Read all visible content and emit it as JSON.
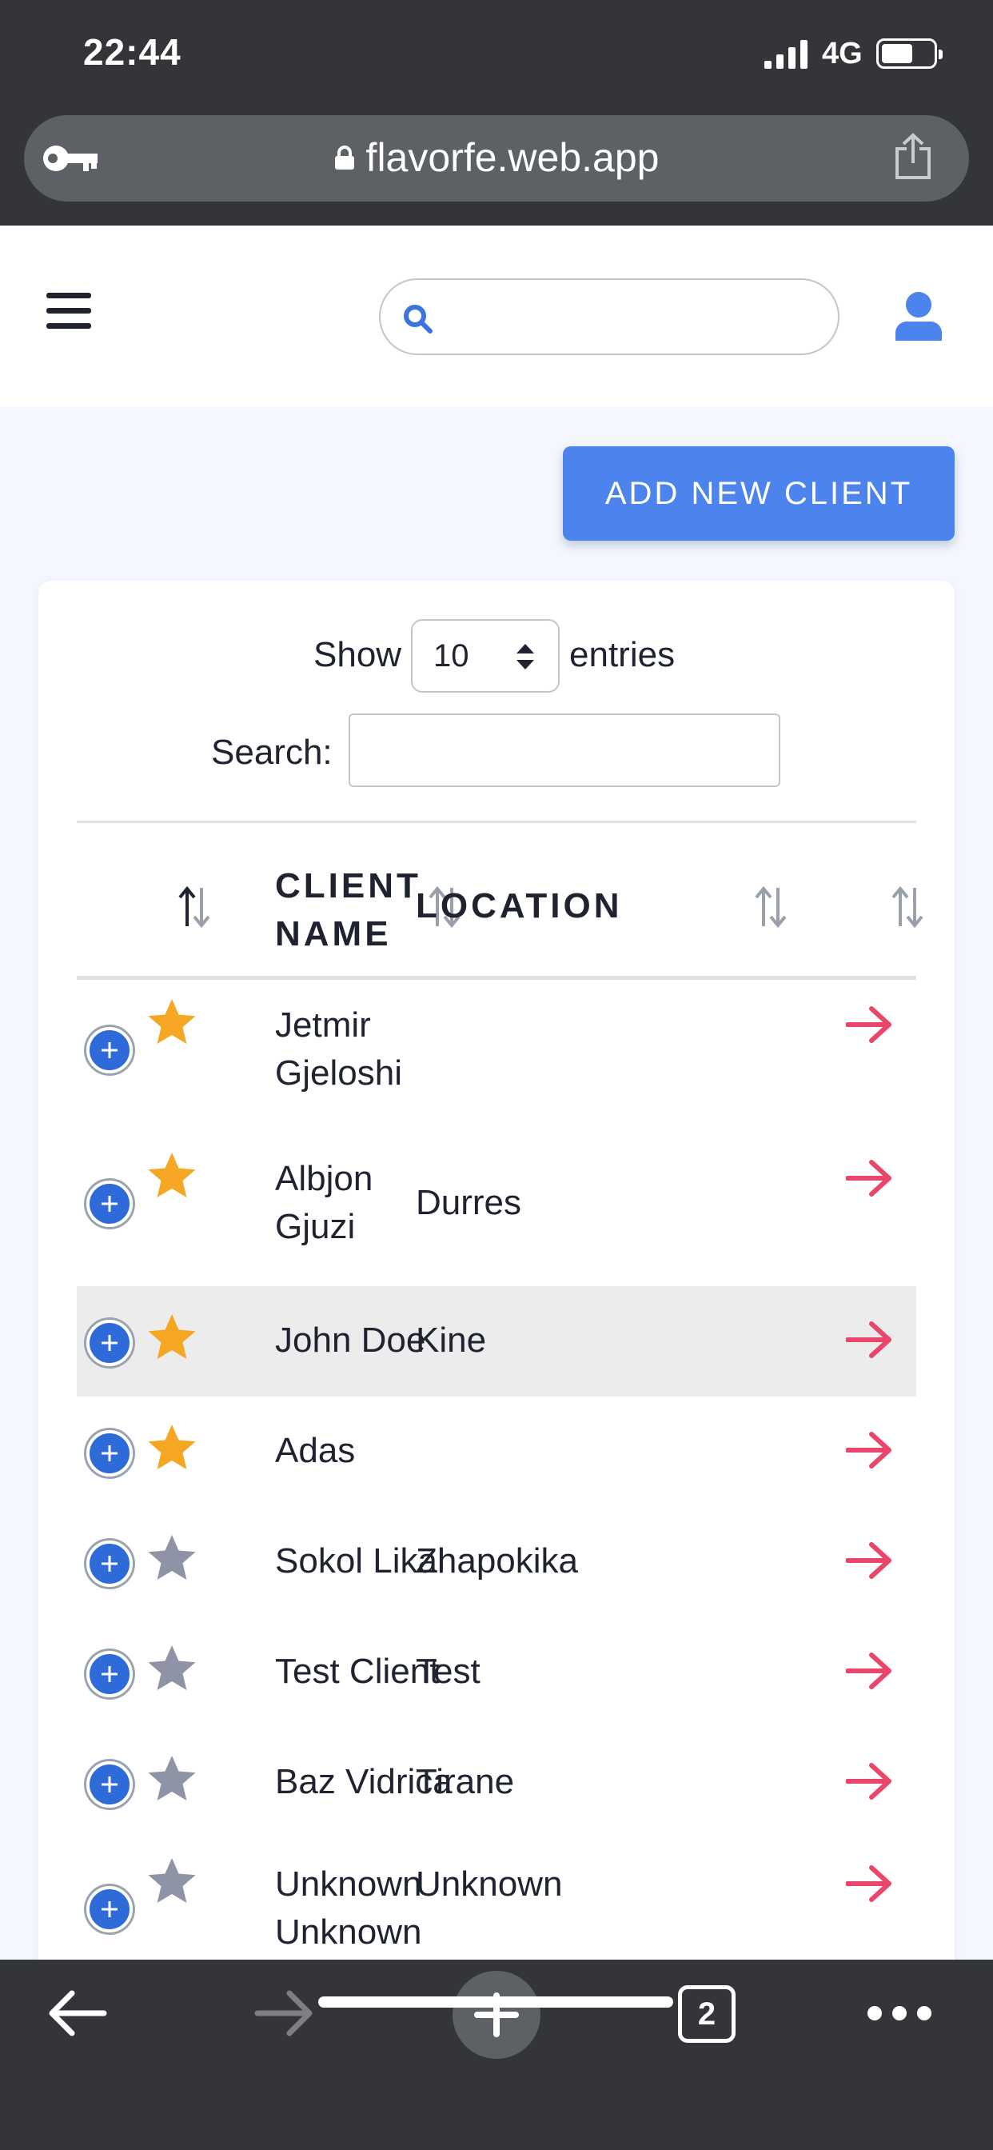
{
  "status_bar": {
    "time": "22:44",
    "network": "4G"
  },
  "browser": {
    "url": "flavorfe.web.app",
    "tab_count": "2"
  },
  "header": {
    "search_placeholder": ""
  },
  "actions": {
    "add_new_client": "ADD NEW CLIENT"
  },
  "table_controls": {
    "show_label": "Show",
    "entries_value": "10",
    "entries_label": "entries",
    "search_label": "Search:"
  },
  "table": {
    "columns": [
      "CLIENT NAME",
      "LOCATION"
    ],
    "rows": [
      {
        "favorite": true,
        "name": "Jetmir Gjeloshi",
        "location": ""
      },
      {
        "favorite": true,
        "name": "Albjon Gjuzi",
        "location": "Durres"
      },
      {
        "favorite": true,
        "name": "John Doe",
        "location": "Kine",
        "highlighted": true
      },
      {
        "favorite": true,
        "name": "Adas",
        "location": ""
      },
      {
        "favorite": false,
        "name": "Sokol Likal",
        "location": "Zhapokika"
      },
      {
        "favorite": false,
        "name": "Test Client",
        "location": "Test"
      },
      {
        "favorite": false,
        "name": "Baz Vidrica",
        "location": "Tirane"
      },
      {
        "favorite": false,
        "name": "Unknown Unknown",
        "location": "Unknown"
      }
    ]
  },
  "colors": {
    "accent": "#4d83ec",
    "expand_button": "#2f6ad9",
    "star_favorite": "#f5a623",
    "star_default": "#8e94a6",
    "go_arrow": "#e8476b",
    "browser_chrome": "#343538"
  },
  "icons": {
    "browser": [
      "key-icon",
      "lock-icon",
      "share-icon",
      "back-icon",
      "forward-icon",
      "plus-icon",
      "tabs-icon",
      "more-icon"
    ],
    "app": [
      "hamburger-icon",
      "search-icon",
      "user-icon",
      "sort-icon",
      "expand-icon",
      "star-icon",
      "arrow-right-icon"
    ]
  }
}
